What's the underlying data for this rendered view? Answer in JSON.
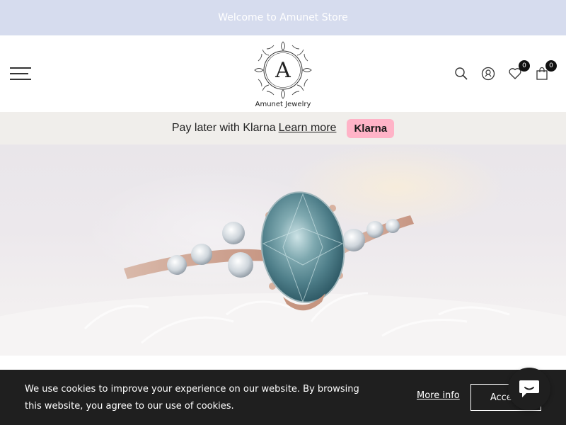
{
  "announcement": {
    "text": "Welcome to Amunet Store"
  },
  "header": {
    "logo_letter": "A",
    "logo_text": "Amunet Jewelry",
    "wishlist_count": "0",
    "cart_count": "0"
  },
  "klarna": {
    "text": "Pay later with Klarna",
    "link": "Learn more",
    "badge": "Klarna"
  },
  "cookie": {
    "text": "We use cookies to improve your experience on our website. By browsing this website, you agree to our use of cookies.",
    "more_info": "More info",
    "accept": "Accept"
  },
  "icons": [
    "hamburger-menu-icon",
    "search-icon",
    "account-icon",
    "wishlist-heart-icon",
    "cart-bag-icon",
    "chat-icon"
  ],
  "colors": {
    "announcement_bg": "#d6dcee",
    "klarna_bar_bg": "#f0eeeb",
    "klarna_badge": "#ffb3c7",
    "cookie_bg": "#1f1f1f"
  }
}
